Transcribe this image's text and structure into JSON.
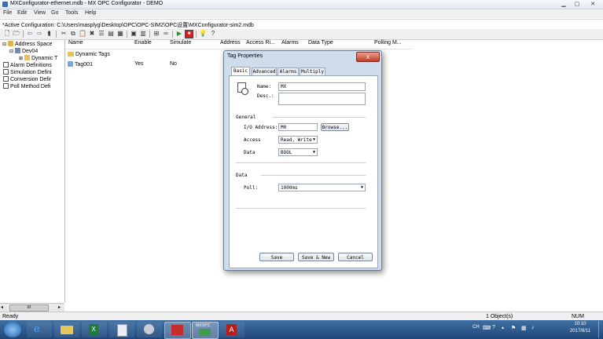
{
  "window": {
    "title": "MXConfigurator-ethernet.mdb - MX OPC Configurator - DEMO"
  },
  "menu": [
    "File",
    "Edit",
    "View",
    "Go",
    "Tools",
    "Help"
  ],
  "config_line": "*Active Configuration: C:\\Users\\masplyg\\Desktop\\OPC\\OPC-SIM2\\OPC设置\\MXConfigurator-sim2.mdb",
  "tree": {
    "root": "Address Space",
    "dev": "Dev04",
    "dyn": "Dynamic T",
    "alarm": "Alarm Definitions",
    "sim": "Simulation Defini",
    "conv": "Conversion Defir",
    "poll": "Poll Method Defi"
  },
  "list": {
    "headers": {
      "name": "Name",
      "enable": "Enable",
      "simulate": "Simulate",
      "address": "Address",
      "access": "Access Ri...",
      "alarms": "Alarms",
      "datatype": "Data Type",
      "polling": "Polling M..."
    },
    "rows": [
      {
        "name": "Dynamic Tags",
        "enable": "",
        "simulate": ""
      },
      {
        "name": "Tag001",
        "enable": "Yes",
        "simulate": "No"
      }
    ]
  },
  "dialog": {
    "title": "Tag Properties",
    "close": "x",
    "tabs": [
      "Basic",
      "Advanced",
      "Alarms",
      "Multiply"
    ],
    "name_label": "Name:",
    "name_value": "MX",
    "desc_label": "Desc.:",
    "desc_value": "",
    "general_label": "General",
    "io_label": "I/O Address:",
    "io_value": "M0",
    "browse": "Browse...",
    "access_label": "Access",
    "access_value": "Read, Write",
    "data_label": "Data",
    "data_value": "BOOL",
    "data_section": "Data",
    "poll_label": "Poll:",
    "poll_value": "1000ms",
    "btn_save": "Save",
    "btn_save_new": "Save & New",
    "btn_cancel": "Cancel"
  },
  "statusbar": {
    "left": "Ready",
    "objects": "1 Object(s)",
    "num": "NUM"
  },
  "taskbar": {
    "lang": "CH",
    "time": "10:10",
    "date": "2017/8/11",
    "app_label": "MXOPC"
  },
  "tree_scroll": "III"
}
